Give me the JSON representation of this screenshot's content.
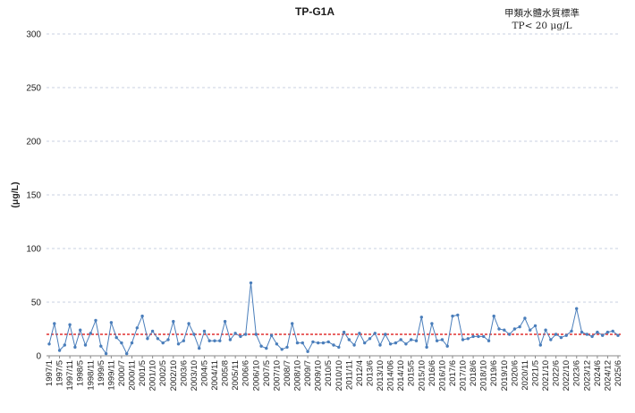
{
  "chart_data": {
    "type": "line",
    "title": "TP-G1A",
    "standard_line1": "甲類水體水質標準",
    "standard_line2": "TP< 20 μg/L",
    "ylabel": "(μg/L)",
    "xlabel": "",
    "ylim": [
      0,
      300
    ],
    "yticks": [
      0,
      50,
      100,
      150,
      200,
      250,
      300
    ],
    "grid": true,
    "legend": "none",
    "standard_value": 20,
    "colors": {
      "series": "#4a7ebb",
      "marker": "#4a7ebb",
      "standard": "#e03030"
    },
    "xtick_labels": [
      "1997/1",
      "1997/5",
      "1997/11",
      "1998/5",
      "1998/11",
      "1999/5",
      "1999/11",
      "2000/7",
      "2000/11",
      "2001/5",
      "2001/10",
      "2002/5",
      "2002/10",
      "2003/6",
      "2003/10",
      "2004/5",
      "2004/11",
      "2005/8",
      "2005/11",
      "2006/6",
      "2006/10",
      "2007/5",
      "2007/10",
      "2008/7",
      "2008/10",
      "2009/7",
      "2009/10",
      "2010/5",
      "2010/10",
      "2011/11",
      "2012/4",
      "2013/6",
      "2013/10",
      "2014/06",
      "2014/10",
      "2015/5",
      "2015/10",
      "2016/6",
      "2016/10",
      "2017/6",
      "2017/10",
      "2018/6",
      "2018/10",
      "2019/6",
      "2019/10",
      "2020/6",
      "2020/11",
      "2021/5",
      "2021/10",
      "2022/6",
      "2022/10",
      "2023/6",
      "2023/12",
      "2024/6",
      "2024/12",
      "2025/6"
    ],
    "series": [
      {
        "values": [
          11,
          30,
          5,
          10,
          29,
          8,
          24,
          10,
          21,
          33,
          9,
          2,
          31,
          17,
          12,
          2,
          12,
          26,
          37,
          16,
          23,
          16,
          12,
          15,
          32,
          11,
          14,
          30,
          20,
          7,
          23,
          14,
          14,
          14,
          32,
          15,
          21,
          18,
          20,
          68,
          20,
          9,
          7,
          19,
          11,
          6,
          8,
          30,
          12,
          12,
          4,
          13,
          12,
          12,
          13,
          10,
          8,
          22,
          15,
          10,
          21,
          12,
          16,
          21,
          10,
          20,
          11,
          12,
          15,
          11,
          15,
          14,
          36,
          8,
          30,
          14,
          15,
          9,
          37,
          38,
          15,
          16,
          18,
          18,
          18,
          14,
          37,
          25,
          24,
          20,
          25,
          27,
          35,
          24,
          28,
          10,
          24,
          15,
          20,
          17,
          19,
          23,
          44,
          22,
          20,
          18,
          22,
          19,
          22,
          23,
          19
        ]
      }
    ]
  }
}
